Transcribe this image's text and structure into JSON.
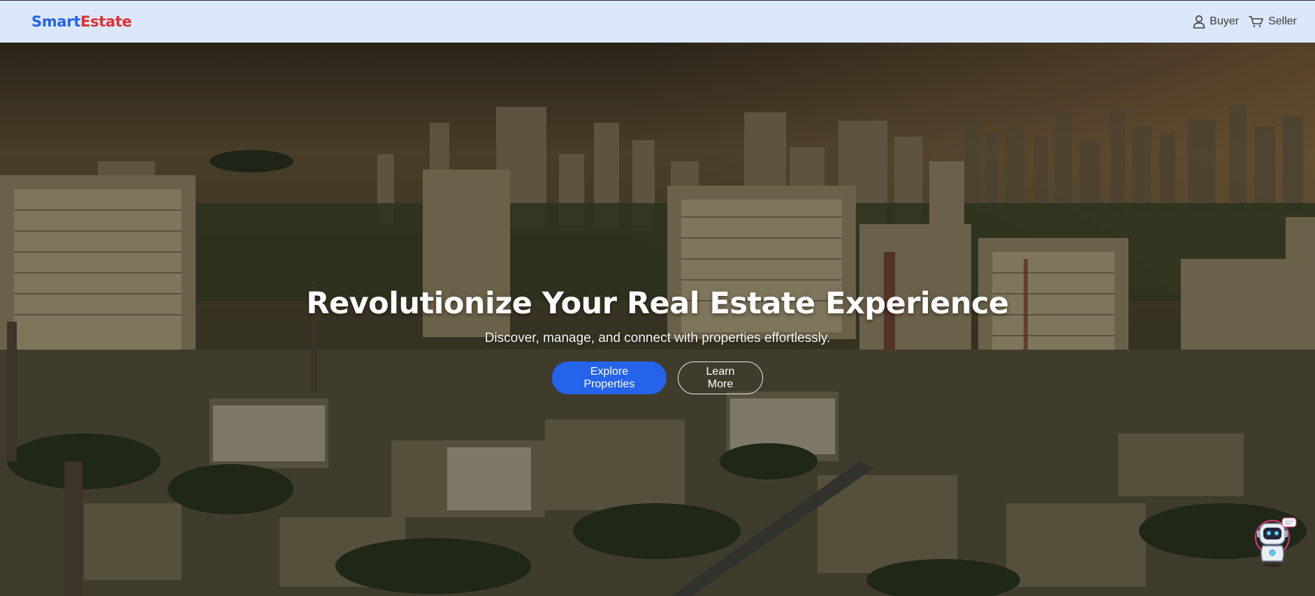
{
  "brand": {
    "part1": "Smart",
    "part2": "Estate"
  },
  "nav": {
    "buyer_label": "Buyer",
    "seller_label": "Seller",
    "buyer_icon": "user-icon",
    "seller_icon": "cart-icon"
  },
  "hero": {
    "title": "Revolutionize Your Real Estate Experience",
    "subtitle": "Discover, manage, and connect with properties effortlessly.",
    "primary_button": "Explore Properties",
    "secondary_button": "Learn More",
    "background": "city-skyline-photo"
  },
  "chatbot": {
    "icon": "robot-assistant-icon"
  },
  "colors": {
    "accent": "#2563eb",
    "brand_red": "#e03131",
    "navbar_bg": "#dbe8fb"
  }
}
